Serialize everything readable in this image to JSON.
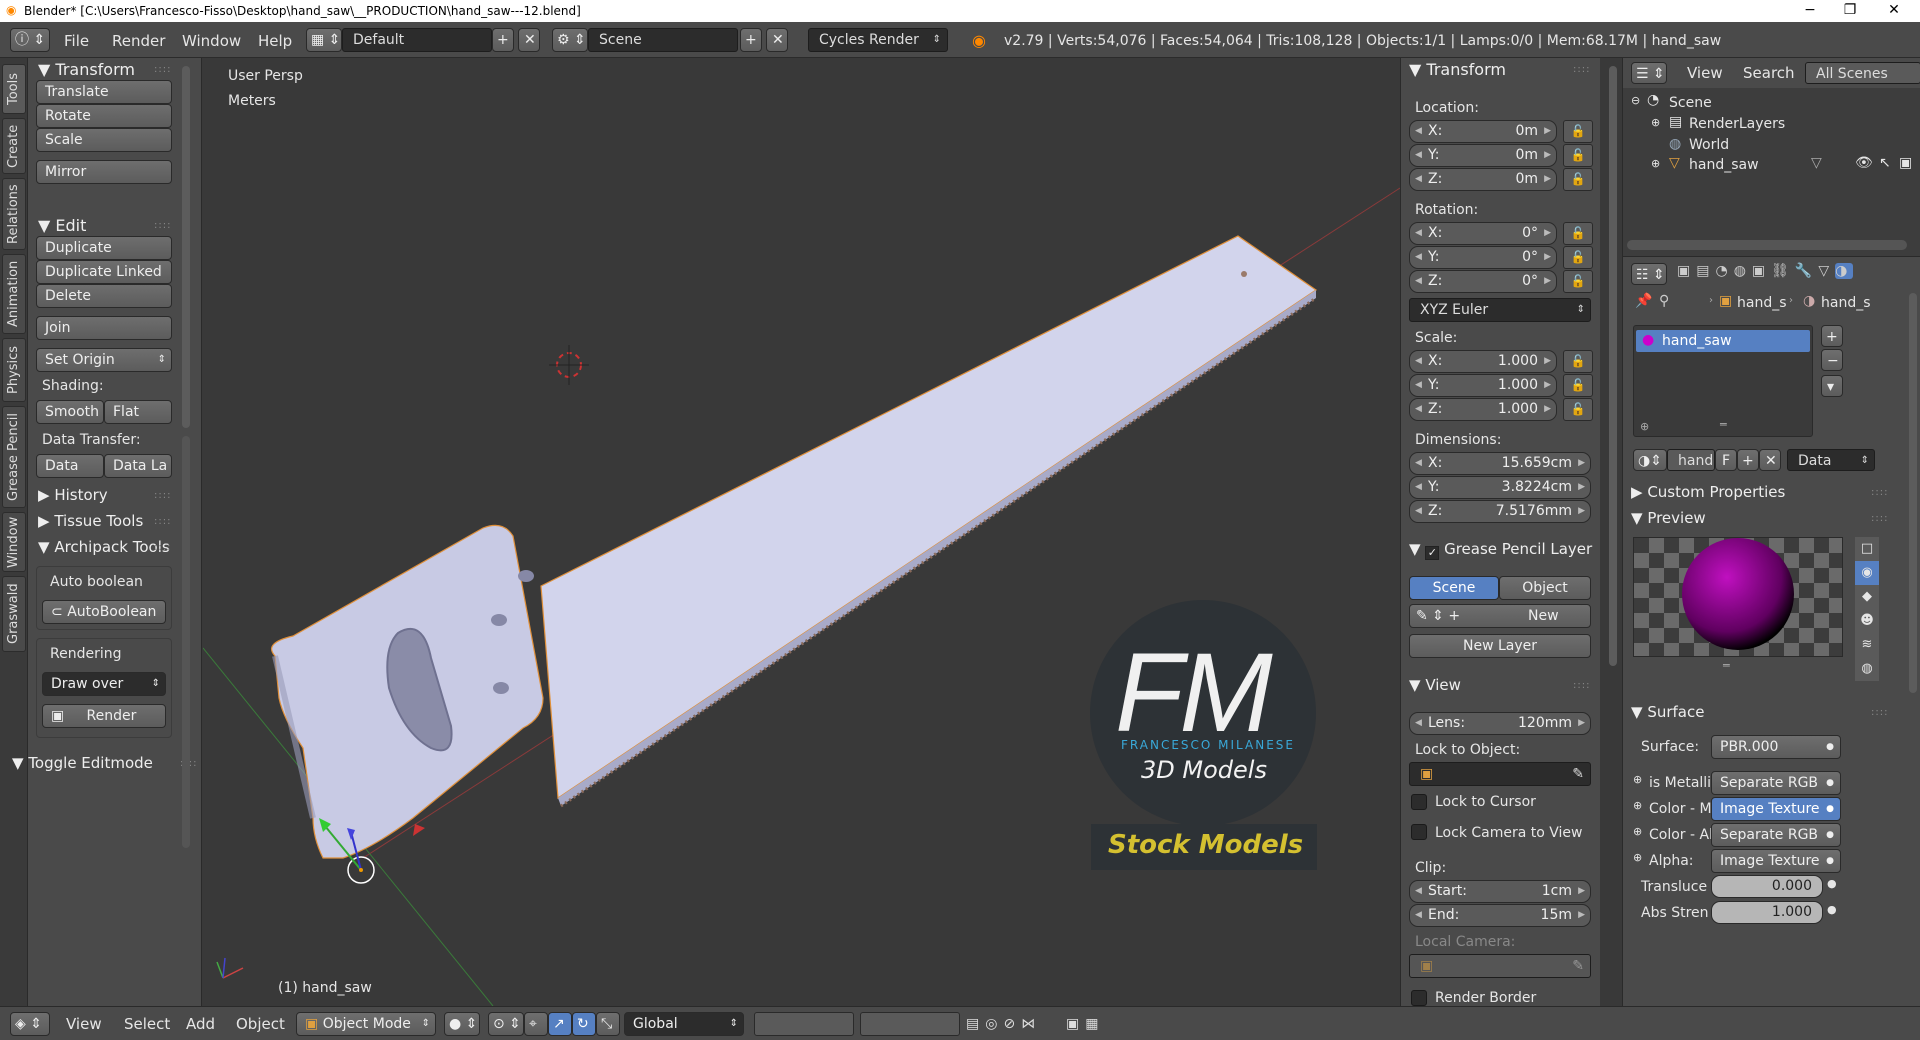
{
  "titlebar": {
    "title": "Blender* [C:\\Users\\Francesco-Fisso\\Desktop\\hand_saw\\__PRODUCTION\\hand_saw---12.blend]",
    "minimize": "−",
    "maximize": "❐",
    "close": "✕"
  },
  "menus": {
    "file": "File",
    "render": "Render",
    "window": "Window",
    "help": "Help"
  },
  "layout": {
    "screen": "Default",
    "scene": "Scene",
    "engine": "Cycles Render"
  },
  "stats": "v2.79 | Verts:54,076 | Faces:54,064 | Tris:108,128 | Objects:1/1 | Lamps:0/0 | Mem:68.17M | hand_saw",
  "left_tabs": [
    "Tools",
    "Create",
    "Relations",
    "Animation",
    "Physics",
    "Grease Pencil",
    "Window",
    "Graswald"
  ],
  "tools": {
    "transform_header": "Transform",
    "translate": "Translate",
    "rotate": "Rotate",
    "scale": "Scale",
    "mirror": "Mirror",
    "edit_header": "Edit",
    "duplicate": "Duplicate",
    "duplicate_linked": "Duplicate Linked",
    "delete": "Delete",
    "join": "Join",
    "set_origin": "Set Origin",
    "shading_label": "Shading:",
    "smooth": "Smooth",
    "flat": "Flat",
    "data_transfer_label": "Data Transfer:",
    "data": "Data",
    "data_layout": "Data La",
    "history": "History",
    "tissue": "Tissue Tools",
    "archipack": "Archipack Tools",
    "auto_boolean_label": "Auto boolean",
    "auto_boolean_btn": "AutoBoolean",
    "rendering_label": "Rendering",
    "draw_over": "Draw over",
    "render_btn": "Render",
    "toggle_editmode": "Toggle Editmode"
  },
  "viewport": {
    "view_name": "User Persp",
    "units": "Meters",
    "object_label": "(1) hand_saw"
  },
  "watermark": {
    "initials": "FM",
    "author": "FRANCESCO MILANESE",
    "sub": "3D Models",
    "stock": "Stock Models"
  },
  "npanel": {
    "transform_header": "Transform",
    "location_label": "Location:",
    "loc": [
      {
        "axis": "X:",
        "val": "0m"
      },
      {
        "axis": "Y:",
        "val": "0m"
      },
      {
        "axis": "Z:",
        "val": "0m"
      }
    ],
    "rotation_label": "Rotation:",
    "rot": [
      {
        "axis": "X:",
        "val": "0°"
      },
      {
        "axis": "Y:",
        "val": "0°"
      },
      {
        "axis": "Z:",
        "val": "0°"
      }
    ],
    "rot_mode": "XYZ Euler",
    "scale_label": "Scale:",
    "scl": [
      {
        "axis": "X:",
        "val": "1.000"
      },
      {
        "axis": "Y:",
        "val": "1.000"
      },
      {
        "axis": "Z:",
        "val": "1.000"
      }
    ],
    "dim_label": "Dimensions:",
    "dim": [
      {
        "axis": "X:",
        "val": "15.659cm"
      },
      {
        "axis": "Y:",
        "val": "3.8224cm"
      },
      {
        "axis": "Z:",
        "val": "7.5176mm"
      }
    ],
    "gp_header": "Grease Pencil Layer",
    "gp_scene": "Scene",
    "gp_object": "Object",
    "gp_new": "New",
    "gp_new_layer": "New Layer",
    "view_header": "View",
    "lens_label": "Lens:",
    "lens_val": "120mm",
    "lock_obj_label": "Lock to Object:",
    "lock_cursor": "Lock to Cursor",
    "lock_camera": "Lock Camera to View",
    "clip_label": "Clip:",
    "clip_start_label": "Start:",
    "clip_start": "1cm",
    "clip_end_label": "End:",
    "clip_end": "15m",
    "local_camera": "Local Camera:",
    "render_border": "Render Border"
  },
  "outliner": {
    "view": "View",
    "search": "Search",
    "scope": "All Scenes",
    "items": [
      "Scene",
      "RenderLayers",
      "World",
      "hand_saw"
    ]
  },
  "props": {
    "breadcrumb_obj": "hand_s",
    "breadcrumb_mat": "hand_s",
    "material_slot": "hand_saw",
    "mat_name": "hand",
    "mat_f": "F",
    "mat_link": "Data",
    "custom_props": "Custom Properties",
    "preview": "Preview",
    "surface_header": "Surface",
    "surface_label": "Surface:",
    "surface_val": "PBR.000",
    "rows": [
      {
        "label": "is Metallic",
        "val": "Separate RGB"
      },
      {
        "label": "Color - Ma",
        "val": "Image Texture"
      },
      {
        "label": "Color - Ab",
        "val": "Separate RGB"
      },
      {
        "label": "Alpha:",
        "val": "Image Texture"
      }
    ],
    "translucency_label": "Transluce",
    "translucency_val": "0.000",
    "abs_label": "Abs Stren",
    "abs_val": "1.000"
  },
  "bottombar": {
    "view": "View",
    "select": "Select",
    "add": "Add",
    "object": "Object",
    "mode": "Object Mode",
    "orientation": "Global"
  }
}
